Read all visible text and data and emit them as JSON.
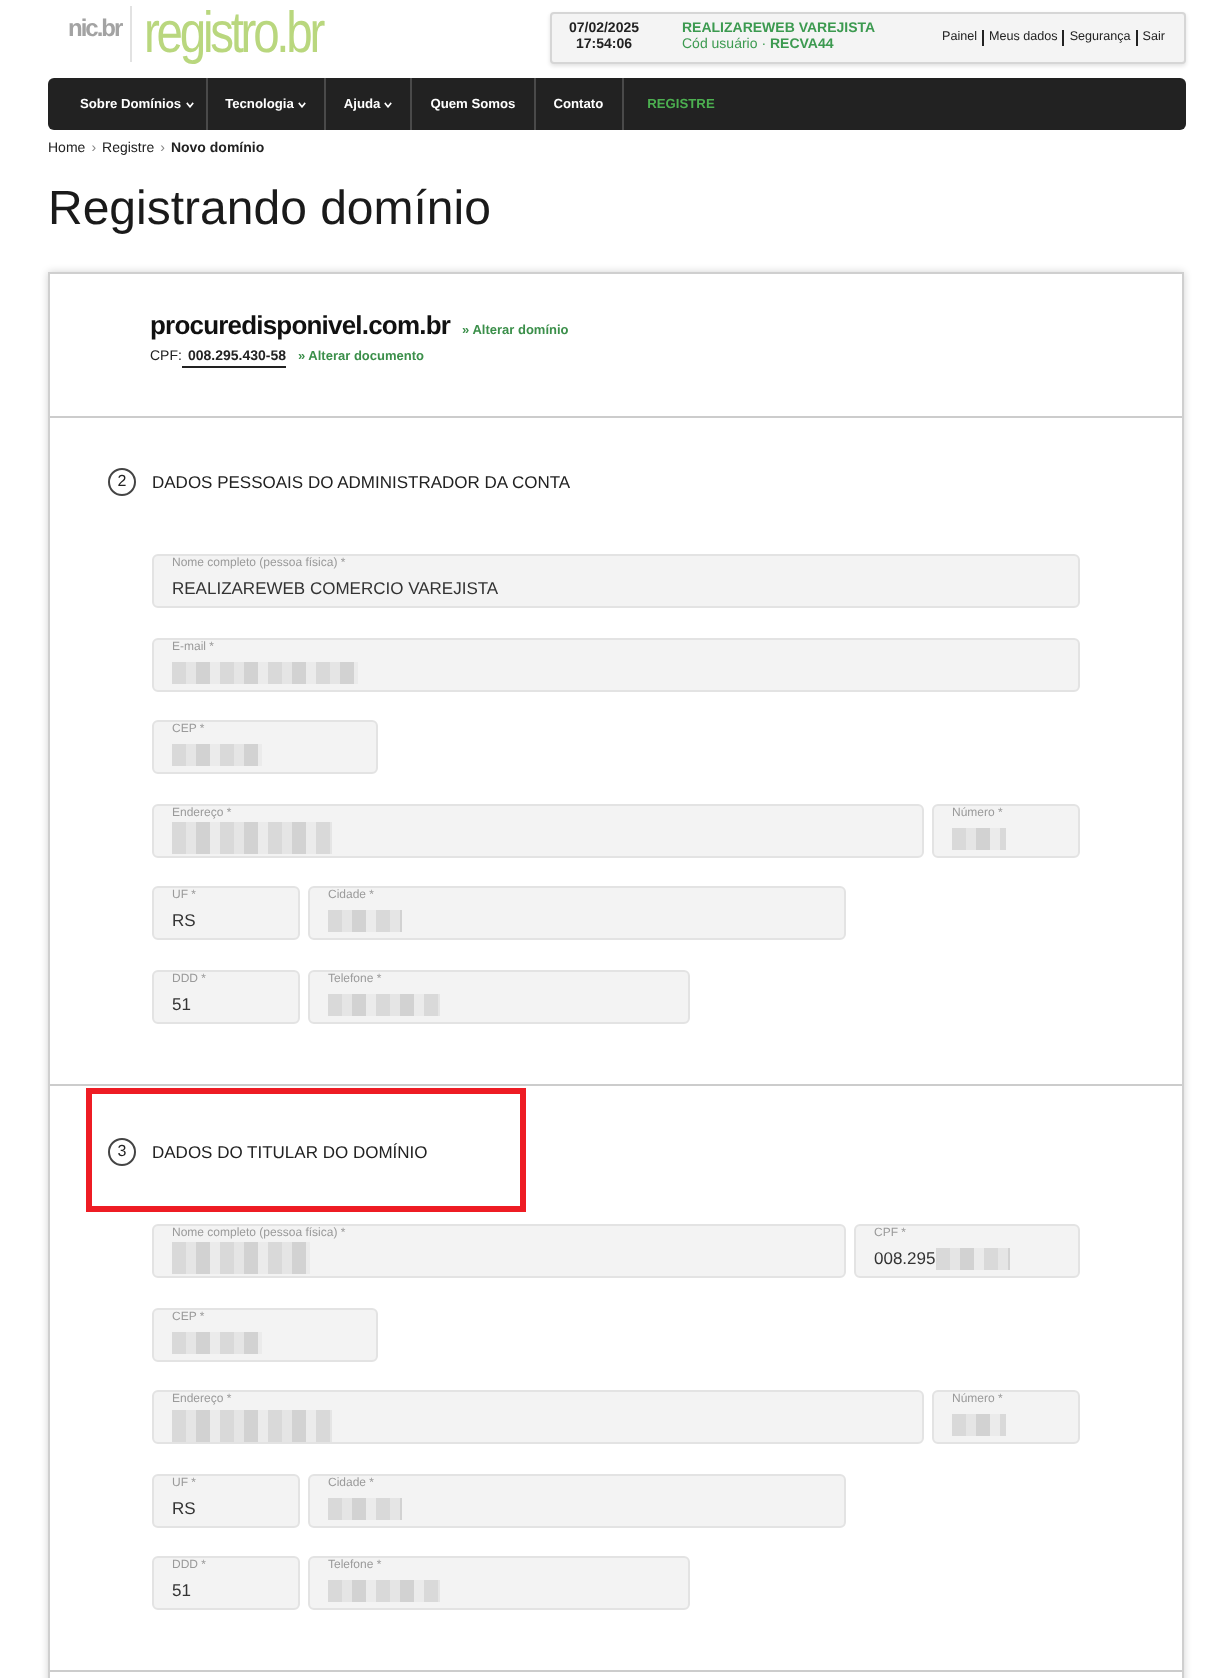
{
  "header": {
    "logo_small": "nic.br",
    "logo_main": "registro.br",
    "session": {
      "date": "07/02/2025",
      "time": "17:54:06",
      "user": "REALIZAREWEB VAREJISTA",
      "code_line": "Cód usuário · **RECVA44**"
    },
    "links": [
      "Painel",
      "Meus dados",
      "Segurança",
      "Sair"
    ]
  },
  "nav": {
    "items": [
      {
        "label": "Sobre Domínios",
        "kind": "dropdown"
      },
      {
        "label": "Tecnologia",
        "kind": "dropdown"
      },
      {
        "label": "Ajuda",
        "kind": "dropdown"
      },
      {
        "label": "Quem Somos",
        "kind": "link"
      },
      {
        "label": "Contato",
        "kind": "link"
      },
      {
        "label": "REGISTRE",
        "kind": "cta"
      }
    ]
  },
  "breadcrumb": [
    {
      "label": "Home",
      "kind": "link"
    },
    {
      "label": "›",
      "kind": "separator"
    },
    {
      "label": "Registre",
      "kind": "link"
    },
    {
      "label": "›",
      "kind": "separator"
    },
    {
      "label": "Novo domínio",
      "kind": "current"
    }
  ],
  "title": "Registrando domínio",
  "summary": {
    "domain": "procuredisponivel.com.br",
    "change_domain": "» Alterar domínio",
    "document_label": "CPF:",
    "document": "008.295.430-58",
    "change_document": "» Alterar documento"
  },
  "sections": [
    {
      "number": "2",
      "title": "DADOS PESSOAIS DO ADMINISTRADOR DA CONTA",
      "highlighted": false,
      "rows": [
        [
          {
            "kind": "name",
            "label": "Nome completo (pessoa física) *",
            "value": "REALIZAREWEB COMERCIO VAREJISTA",
            "redacted": false
          }
        ],
        [
          {
            "kind": "email",
            "label": "E-mail *",
            "redacted": true
          }
        ],
        [
          {
            "kind": "cep",
            "label": "CEP *",
            "redacted": true
          }
        ],
        [
          {
            "kind": "address",
            "label": "Endereço *",
            "redacted": true
          },
          {
            "kind": "number",
            "label": "Número *",
            "redacted": true
          }
        ],
        [
          {
            "kind": "state",
            "label": "UF *",
            "value": "RS",
            "redacted": false
          },
          {
            "kind": "city",
            "label": "Cidade *",
            "redacted": true
          }
        ],
        [
          {
            "kind": "area-code",
            "label": "DDD *",
            "value": "51",
            "redacted": false
          },
          {
            "kind": "phone",
            "label": "Telefone *",
            "redacted": true
          }
        ]
      ]
    },
    {
      "number": "3",
      "title": "DADOS DO TITULAR DO DOMÍNIO",
      "highlighted": true,
      "rows": [
        [
          {
            "kind": "name",
            "label": "Nome completo (pessoa física) *",
            "redacted": true
          },
          {
            "kind": "cpf",
            "label": "CPF *",
            "value": "008.295",
            "redacted": true
          }
        ],
        [
          {
            "kind": "cep",
            "label": "CEP *",
            "redacted": true
          }
        ],
        [
          {
            "kind": "address",
            "label": "Endereço *",
            "redacted": true
          },
          {
            "kind": "number",
            "label": "Número *",
            "redacted": true
          }
        ],
        [
          {
            "kind": "state",
            "label": "UF *",
            "value": "RS",
            "redacted": false
          },
          {
            "kind": "city",
            "label": "Cidade *",
            "redacted": true
          }
        ],
        [
          {
            "kind": "area-code",
            "label": "DDD *",
            "value": "51",
            "redacted": false
          },
          {
            "kind": "phone",
            "label": "Telefone *",
            "redacted": true
          }
        ]
      ]
    }
  ]
}
